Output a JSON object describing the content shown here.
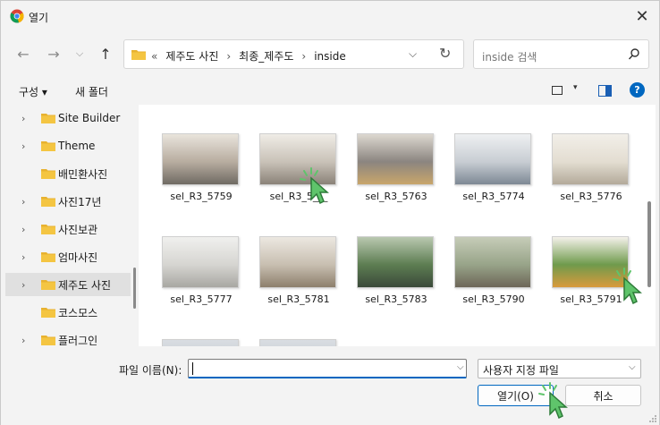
{
  "window": {
    "title": "열기",
    "close_glyph": "✕"
  },
  "nav": {
    "back_glyph": "←",
    "forward_glyph": "→",
    "recent_glyph": "⌵",
    "up_glyph": "↑"
  },
  "address": {
    "overflow": "«",
    "crumbs": [
      "제주도 사진",
      "최종_제주도",
      "inside"
    ],
    "separator": "›",
    "dropdown_glyph": "⌵",
    "refresh_glyph": "↻"
  },
  "search": {
    "placeholder": "inside 검색"
  },
  "toolbar": {
    "organize_label": "구성 ▾",
    "new_folder_label": "새 폴더",
    "view_caret": "▾",
    "help_label": "?"
  },
  "nav_tree": {
    "items": [
      {
        "label": "Site Builder",
        "chevron": "›"
      },
      {
        "label": "Theme",
        "chevron": "›"
      },
      {
        "label": "배민환사진",
        "chevron": ""
      },
      {
        "label": "사진17년",
        "chevron": "›"
      },
      {
        "label": "사진보관",
        "chevron": "›"
      },
      {
        "label": "엄마사진",
        "chevron": "›"
      },
      {
        "label": "제주도 사진",
        "chevron": "›"
      },
      {
        "label": "코스모스",
        "chevron": ""
      },
      {
        "label": "플러그인",
        "chevron": "›"
      }
    ],
    "selected_index": 6
  },
  "files": [
    {
      "name": "sel_R3_5759"
    },
    {
      "name": "sel_R3_5___"
    },
    {
      "name": "sel_R3_5763"
    },
    {
      "name": "sel_R3_5774"
    },
    {
      "name": "sel_R3_5776"
    },
    {
      "name": "sel_R3_5777"
    },
    {
      "name": "sel_R3_5781"
    },
    {
      "name": "sel_R3_5783"
    },
    {
      "name": "sel_R3_5790"
    },
    {
      "name": "sel_R3_5791"
    }
  ],
  "bottom": {
    "filename_label": "파일 이름(N):",
    "filename_value": "",
    "dropdown_glyph": "⌵",
    "filter_value": "사용자 지정 파일",
    "open_label": "열기(O)",
    "cancel_label": "취소"
  },
  "colors": {
    "accent": "#0067c0",
    "folder": "#f4c542",
    "cursor_green": "#5fc46b"
  }
}
